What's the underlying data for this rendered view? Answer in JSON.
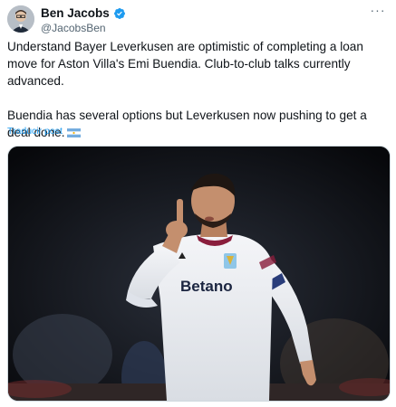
{
  "author": {
    "name": "Ben Jacobs",
    "handle": "@JacobsBen",
    "verified": true
  },
  "tweet": {
    "paragraph1": "Understand Bayer Leverkusen are optimistic of completing a loan move for Aston Villa's Emi Buendia. Club-to-club talks currently advanced.",
    "paragraph2": "Buendia has several options but Leverkusen now pushing to get a deal done.",
    "flag_icon": "argentina-flag-icon"
  },
  "translate_label": "Traducir post",
  "media": {
    "jersey_sponsor": "Betano"
  },
  "colors": {
    "accent": "#1d9bf0",
    "secondary_text": "#536471",
    "primary_text": "#0f1419"
  }
}
